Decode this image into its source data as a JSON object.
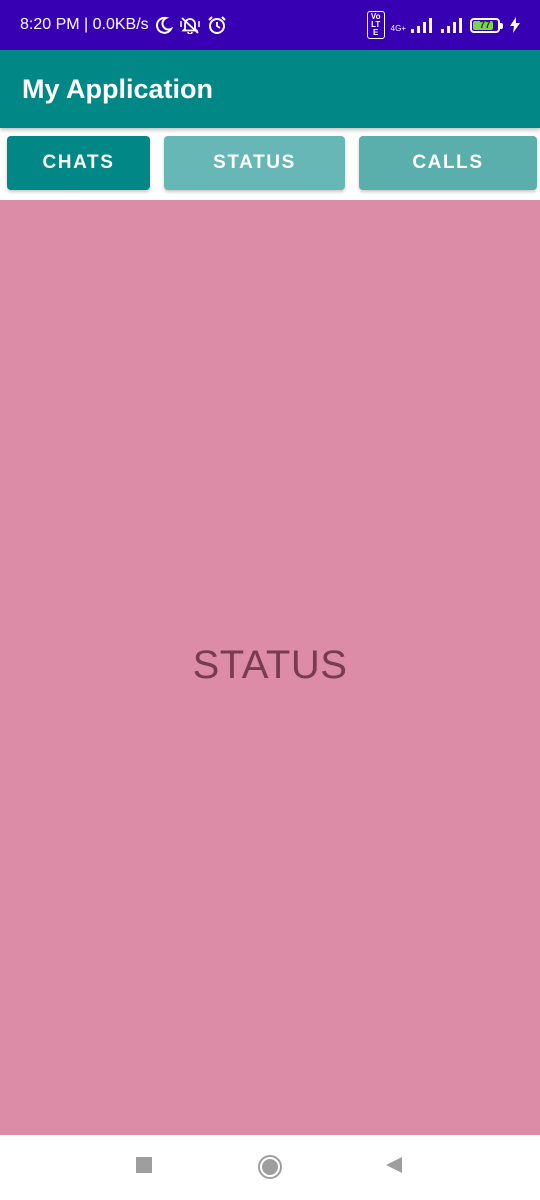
{
  "status_bar": {
    "time_speed": "8:20 PM | 0.0KB/s",
    "volte_label": "Vo LTE",
    "network_label": "4G+",
    "battery_level": "77",
    "icons": [
      "moon-icon",
      "vibrate-mute-icon",
      "alarm-icon",
      "volte-icon",
      "signal-icon",
      "signal-icon",
      "battery-icon",
      "charging-icon"
    ]
  },
  "app_bar": {
    "title": "My Application"
  },
  "tabs": [
    {
      "label": "CHATS",
      "selected": false
    },
    {
      "label": "STATUS",
      "selected": true
    },
    {
      "label": "CALLS",
      "selected": false
    }
  ],
  "content": {
    "label": "STATUS"
  },
  "nav_bar": {
    "icons": [
      "recents-square-icon",
      "home-circle-icon",
      "back-triangle-icon"
    ]
  },
  "colors": {
    "status_bar": "#3700b3",
    "app_bar": "#018786",
    "tab_chats": "#018786",
    "tab_status": "#66b7b6",
    "tab_calls": "#5aaeac",
    "content_bg": "#dd8ca7",
    "content_text": "#7a3a52"
  }
}
